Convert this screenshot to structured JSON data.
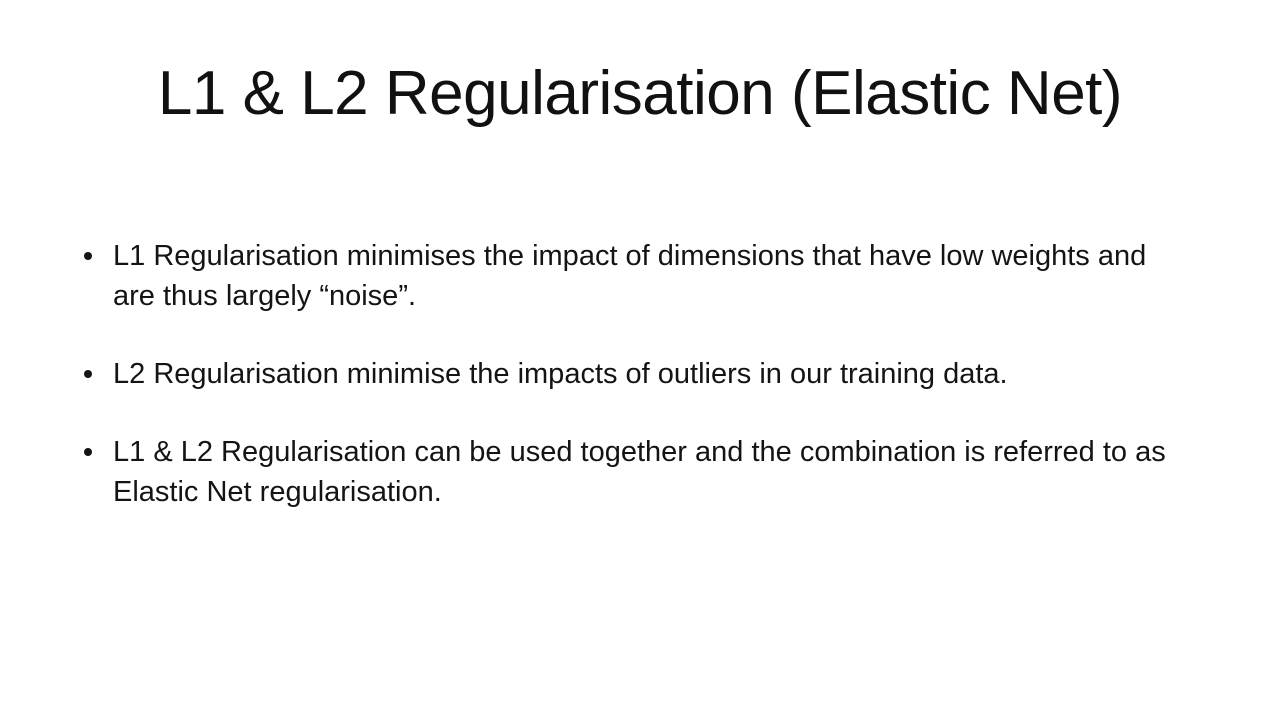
{
  "slide": {
    "title": "L1 & L2 Regularisation (Elastic Net)",
    "bullets": [
      {
        "text": "L1 Regularisation minimises the impact of dimensions that have low weights and are thus largely “noise”."
      },
      {
        "text": "L2 Regularisation minimise the impacts of outliers in our training data."
      },
      {
        "text": "L1 & L2 Regularisation can be used together and the combination is referred to as Elastic Net regularisation."
      }
    ]
  }
}
